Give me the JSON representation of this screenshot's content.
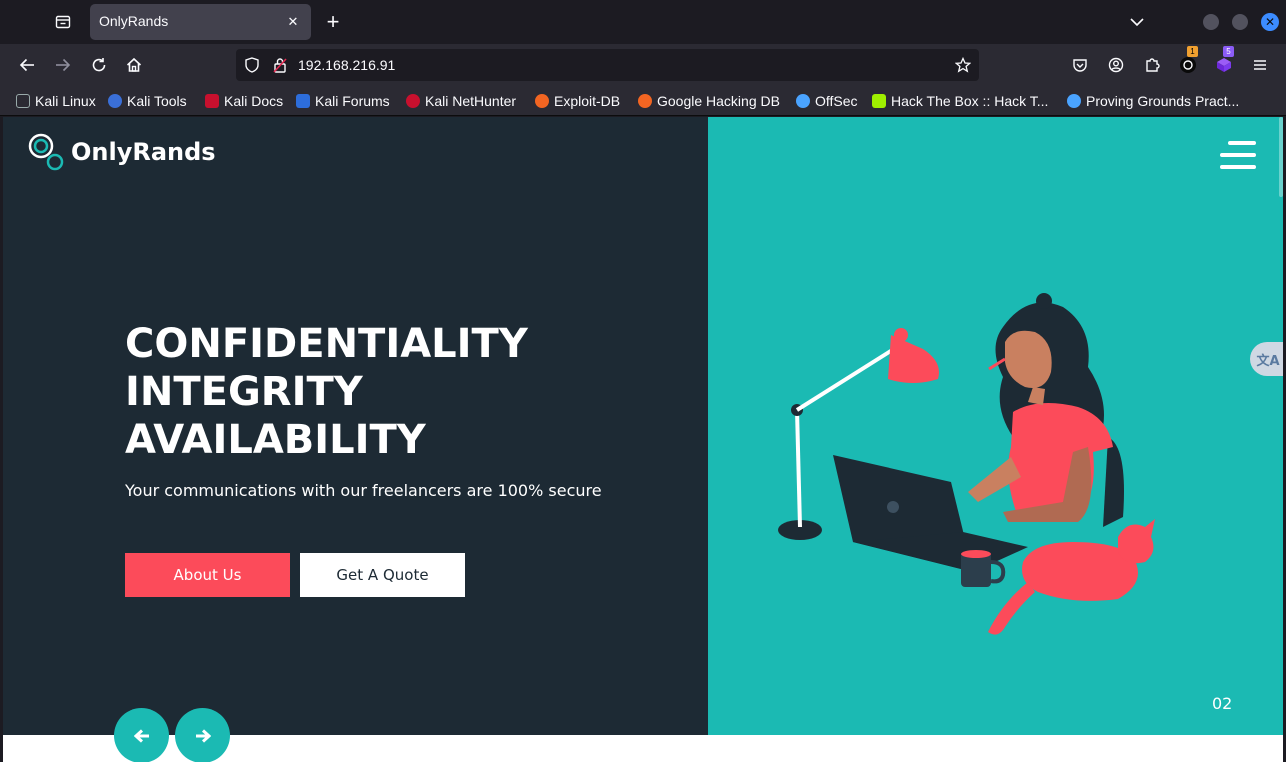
{
  "browser": {
    "tab_title": "OnlyRands",
    "url": "192.168.216.91",
    "notification_badge_1": "1",
    "notification_badge_2": "5"
  },
  "bookmarks": [
    {
      "label": "Kali Linux",
      "color": "#1e90ff"
    },
    {
      "label": "Kali Tools",
      "color": "#e0413a"
    },
    {
      "label": "Kali Docs",
      "color": "#c8102e"
    },
    {
      "label": "Kali Forums",
      "color": "#2d6ddb"
    },
    {
      "label": "Kali NetHunter",
      "color": "#c8102e"
    },
    {
      "label": "Exploit-DB",
      "color": "#f26522"
    },
    {
      "label": "Google Hacking DB",
      "color": "#f26522"
    },
    {
      "label": "OffSec",
      "color": "#4aa3ff"
    },
    {
      "label": "Hack The Box :: Hack T...",
      "color": "#9fef00"
    },
    {
      "label": "Proving Grounds Pract...",
      "color": "#4aa3ff"
    }
  ],
  "page": {
    "logo_text": "OnlyRands",
    "headline": [
      "CONFIDENTIALITY",
      "INTEGRITY",
      "AVAILABILITY"
    ],
    "subline": "Your communications with our freelancers are 100% secure",
    "about_button": "About Us",
    "quote_button": "Get A Quote",
    "slide_number": "02",
    "colors": {
      "dark": "#1d2a34",
      "teal": "#1bbab3",
      "accent": "#fc4b5a"
    }
  }
}
